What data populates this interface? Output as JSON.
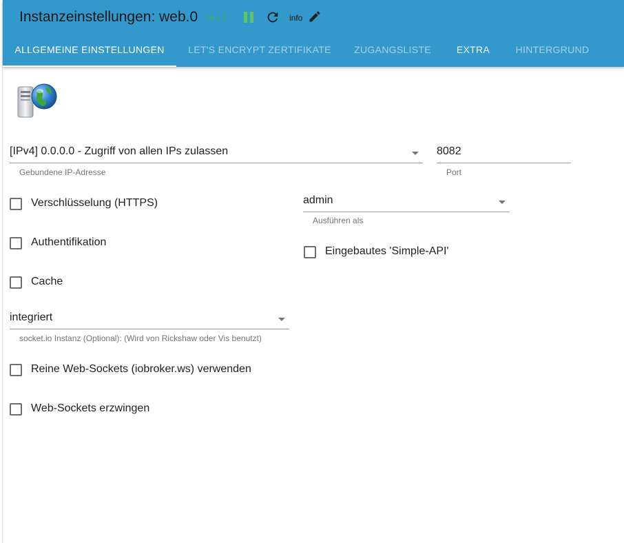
{
  "header": {
    "title": "Instanzeinstellungen: web.0",
    "version": "v6.1.1",
    "info_label": "info"
  },
  "tabs": [
    {
      "label": "ALLGEMEINE EINSTELLUNGEN"
    },
    {
      "label": "LET'S ENCRYPT ZERTIFIKATE"
    },
    {
      "label": "ZUGANGSLISTE"
    },
    {
      "label": "EXTRA"
    },
    {
      "label": "HINTERGRUND"
    }
  ],
  "form": {
    "bind_ip": {
      "value": "[IPv4] 0.0.0.0 - Zugriff von allen IPs zulassen",
      "helper": "Gebundene IP-Adresse"
    },
    "port": {
      "value": "8082",
      "helper": "Port"
    },
    "https": {
      "label": "Verschlüsselung (HTTPS)",
      "checked": false
    },
    "run_as": {
      "value": "admin",
      "helper": "Ausführen als"
    },
    "auth": {
      "label": "Authentifikation",
      "checked": false
    },
    "simple_api": {
      "label": "Eingebautes 'Simple-API'",
      "checked": false
    },
    "cache": {
      "label": "Cache",
      "checked": false
    },
    "socketio": {
      "value": "integriert",
      "helper": "socket.io Instanz (Optional): (Wird von Rickshaw oder Vis benutzt)"
    },
    "pure_ws": {
      "label": "Reine Web-Sockets (iobroker.ws) verwenden",
      "checked": false
    },
    "force_ws": {
      "label": "Web-Sockets erzwingen",
      "checked": false
    }
  },
  "colors": {
    "header_bg": "#3399cc",
    "version": "#3fb34f",
    "pause": "#5fc45f"
  }
}
